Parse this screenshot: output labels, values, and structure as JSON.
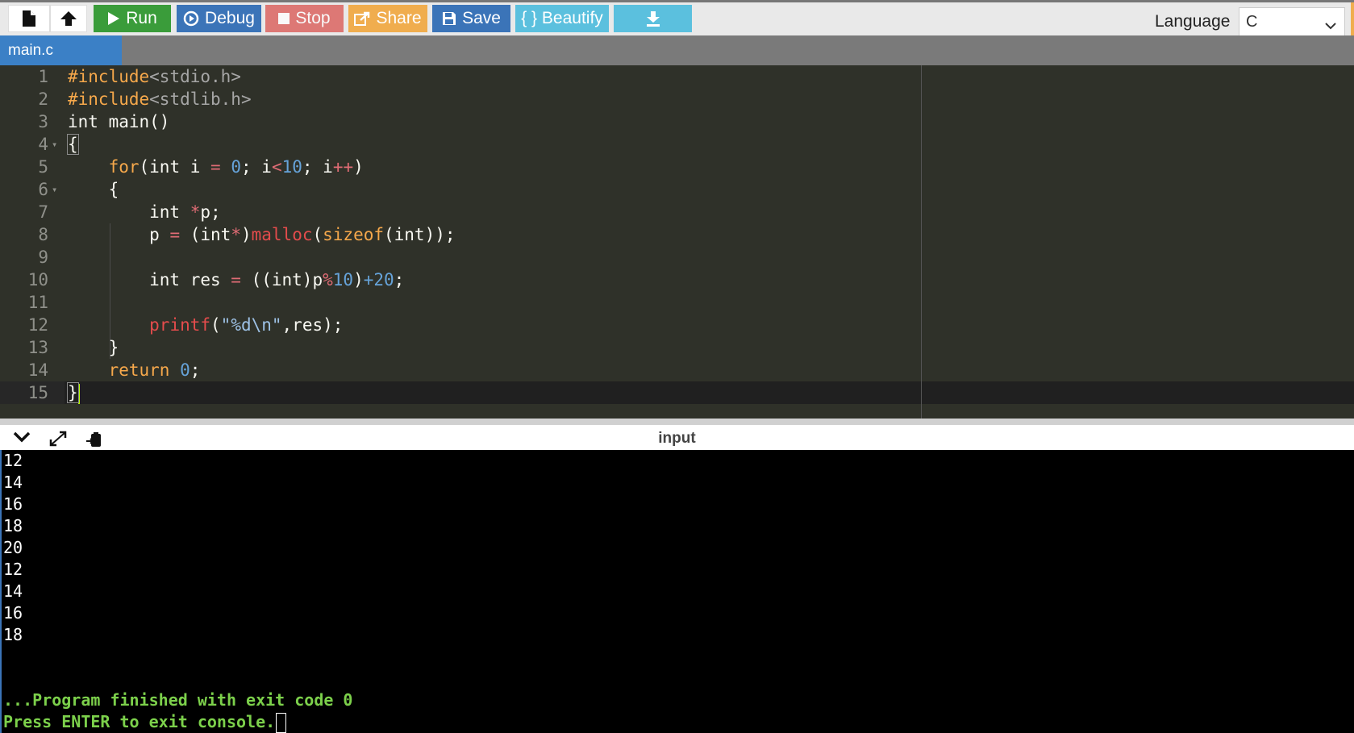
{
  "toolbar": {
    "new_icon": "file-icon",
    "upload_icon": "upload-icon",
    "run_label": "Run",
    "debug_label": "Debug",
    "stop_label": "Stop",
    "share_label": "Share",
    "save_label": "Save",
    "beautify_label": "{ } Beautify",
    "download_icon": "download-icon",
    "language_label": "Language",
    "language_value": "C",
    "colors": {
      "run": "#3a9c3a",
      "debug": "#3b74b8",
      "stop": "#d9534f",
      "share": "#f0ad4e",
      "save": "#3b74b8",
      "beautify": "#5bc0de"
    }
  },
  "tabs": [
    {
      "label": "main.c"
    }
  ],
  "editor": {
    "line_numbers": [
      "1",
      "2",
      "3",
      "4",
      "5",
      "6",
      "7",
      "8",
      "9",
      "10",
      "11",
      "12",
      "13",
      "14",
      "15"
    ],
    "lines": [
      "#include<stdio.h>",
      "#include<stdlib.h>",
      "int main()",
      "{",
      "    for(int i = 0; i<10; i++)",
      "    {",
      "        int *p;",
      "        p = (int*)malloc(sizeof(int));",
      "",
      "        int res = ((int)p%10)+20;",
      "",
      "        printf(\"%d\\n\",res);",
      "    }",
      "    return 0;",
      "}"
    ]
  },
  "output": {
    "title": "input",
    "lines": [
      "12",
      "14",
      "16",
      "18",
      "20",
      "12",
      "14",
      "16",
      "18"
    ],
    "finished_message": "...Program finished with exit code 0",
    "exit_prompt": "Press ENTER to exit console."
  }
}
